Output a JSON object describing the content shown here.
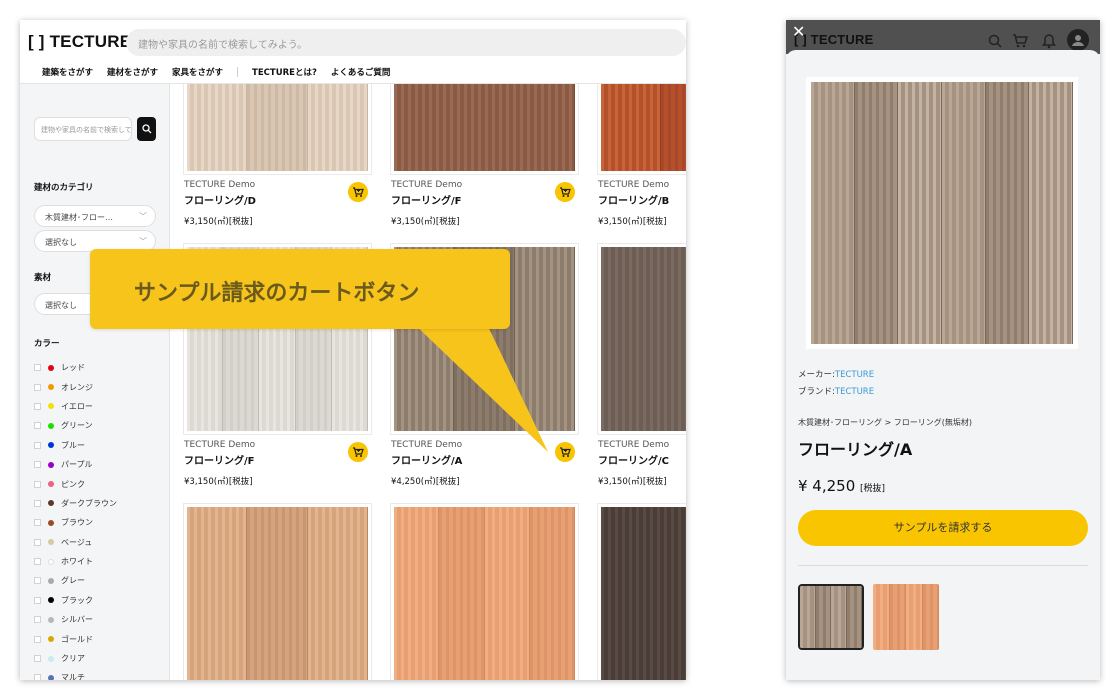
{
  "desktop": {
    "logo": "[ ] TECTURE",
    "search_placeholder": "建物や家具の名前で検索してみよう。",
    "nav": [
      "建築をさがす",
      "建材をさがす",
      "家具をさがす",
      "TECTUREとは?",
      "よくあるご質問"
    ],
    "sidebar": {
      "search_placeholder": "建物や家具の名前で検索して",
      "category_title": "建材のカテゴリ",
      "category_value": "木質建材･フロー…",
      "category_sub": "選択なし",
      "material_title": "素材",
      "material_value": "選択なし",
      "color_title": "カラー",
      "colors": [
        {
          "label": "レッド",
          "color": "#e60012"
        },
        {
          "label": "オレンジ",
          "color": "#f39800"
        },
        {
          "label": "イエロー",
          "color": "#f2e200"
        },
        {
          "label": "グリーン",
          "color": "#1ee000"
        },
        {
          "label": "ブルー",
          "color": "#0034d6"
        },
        {
          "label": "パープル",
          "color": "#9900cc"
        },
        {
          "label": "ピンク",
          "color": "#f06080"
        },
        {
          "label": "ダークブラウン",
          "color": "#5c3a2a"
        },
        {
          "label": "ブラウン",
          "color": "#9b4a2a"
        },
        {
          "label": "ベージュ",
          "color": "#d8c9a5"
        },
        {
          "label": "ホワイト",
          "color": "#ffffff"
        },
        {
          "label": "グレー",
          "color": "#aaaaaa"
        },
        {
          "label": "ブラック",
          "color": "#000000"
        },
        {
          "label": "シルバー",
          "color": "#b8b8b8"
        },
        {
          "label": "ゴールド",
          "color": "#d9a900"
        },
        {
          "label": "クリア",
          "color": "#cfe8f5"
        },
        {
          "label": "マルチ",
          "color": "#5870b8"
        }
      ]
    },
    "products": [
      {
        "brand": "TECTURE Demo",
        "name": "フローリング/D",
        "price": "¥3,150(㎡)[税抜]"
      },
      {
        "brand": "TECTURE Demo",
        "name": "フローリング/F",
        "price": "¥3,150(㎡)[税抜]"
      },
      {
        "brand": "TECTURE Demo",
        "name": "フローリング/B",
        "price": "¥3,150(㎡)[税抜]"
      },
      {
        "brand": "TECTURE Demo",
        "name": "フローリング/F",
        "price": "¥3,150(㎡)[税抜]"
      },
      {
        "brand": "TECTURE Demo",
        "name": "フローリング/A",
        "price": "¥4,250(㎡)[税抜]"
      },
      {
        "brand": "TECTURE Demo",
        "name": "フローリング/C",
        "price": "¥3,150(㎡)[税抜]"
      },
      {
        "brand": "",
        "name": "",
        "price": ""
      },
      {
        "brand": "",
        "name": "",
        "price": ""
      },
      {
        "brand": "",
        "name": "",
        "price": ""
      }
    ],
    "callout": "サンプル請求のカートボタン"
  },
  "mobile": {
    "logo": "[ ] TECTURE",
    "maker_label": "メーカー:",
    "maker": "TECTURE",
    "brand_label": "ブランド:",
    "brand": "TECTURE",
    "breadcrumb": "木質建材･フローリング > フローリング(無垢材)",
    "title": "フローリング/A",
    "price": "¥ 4,250",
    "tax": "[税抜]",
    "cta": "サンプルを請求する"
  },
  "colors": {
    "accent": "#f8c500",
    "callout": "#f6c41b",
    "link": "#3b9bd4"
  }
}
